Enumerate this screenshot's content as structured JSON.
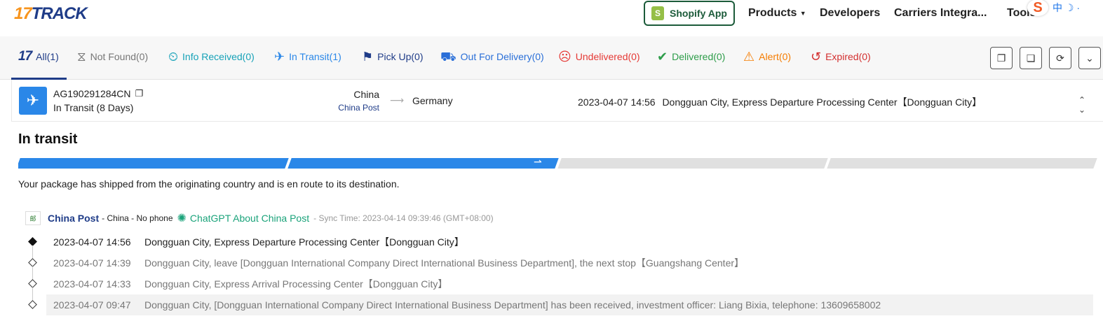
{
  "header": {
    "logo_number": "17",
    "logo_text": "TRACK",
    "shopify_label": "Shopify App",
    "nav": {
      "products": "Products",
      "developers": "Developers",
      "carriers": "Carriers Integra...",
      "tools": "Tools"
    },
    "ime_label": "中 ☽ ·"
  },
  "tabs": [
    {
      "key": "all",
      "label": "All(1)"
    },
    {
      "key": "not_found",
      "label": "Not Found(0)"
    },
    {
      "key": "info_received",
      "label": "Info Received(0)"
    },
    {
      "key": "in_transit",
      "label": "In Transit(1)"
    },
    {
      "key": "pick_up",
      "label": "Pick Up(0)"
    },
    {
      "key": "out_for_delivery",
      "label": "Out For Delivery(0)"
    },
    {
      "key": "undelivered",
      "label": "Undelivered(0)"
    },
    {
      "key": "delivered",
      "label": "Delivered(0)"
    },
    {
      "key": "alert",
      "label": "Alert(0)"
    },
    {
      "key": "expired",
      "label": "Expired(0)"
    }
  ],
  "tabs_labels": {
    "all": "All(1)",
    "not_found": "Not Found(0)",
    "info_received": "Info Received(0)",
    "in_transit": "In Transit(1)",
    "pick_up": "Pick Up(0)",
    "out_for_delivery": "Out For Delivery(0)",
    "undelivered": "Undelivered(0)",
    "delivered": "Delivered(0)",
    "alert": "Alert(0)",
    "expired": "Expired(0)"
  },
  "shipment": {
    "tracking_number": "AG190291284CN",
    "status": "In Transit (8 Days)",
    "origin_country": "China",
    "origin_carrier": "China Post",
    "destination_country": "Germany",
    "latest_time": "2023-04-07 14:56",
    "latest_event": "Dongguan City, Express Departure Processing Center【Dongguan City】"
  },
  "detail": {
    "title": "In transit",
    "progress_completed_segments": 2,
    "progress_total_segments": 4,
    "description": "Your package has shipped from the originating country and is en route to its destination."
  },
  "carrier": {
    "name": "China Post",
    "meta": "- China - No phone",
    "chatgpt_link": "ChatGPT About China Post",
    "sync_time": "- Sync Time: 2023-04-14 09:39:46 (GMT+08:00)"
  },
  "events": [
    {
      "time": "2023-04-07 14:56",
      "text": "Dongguan City, Express Departure Processing Center【Dongguan City】"
    },
    {
      "time": "2023-04-07 14:39",
      "text": "Dongguan City, leave [Dongguan International Company Direct International Business Department], the next stop【Guangshang Center】"
    },
    {
      "time": "2023-04-07 14:33",
      "text": "Dongguan City, Express Arrival Processing Center【Dongguan City】"
    },
    {
      "time": "2023-04-07 09:47",
      "text": "Dongguan City, [Dongguan International Company Direct International Business Department] has been received, investment officer: Liang Bixia, telephone: 13609658002"
    }
  ],
  "colors": {
    "brand_orange": "#f7941d",
    "brand_navy": "#1f3c88",
    "transit_blue": "#2a87e8",
    "chatgpt_green": "#1aa37a"
  }
}
